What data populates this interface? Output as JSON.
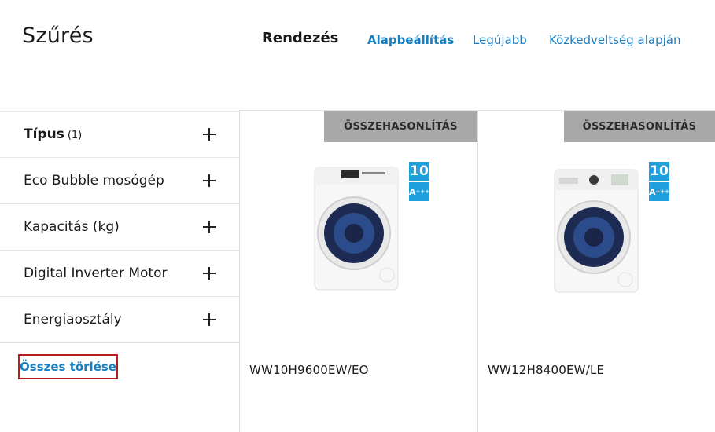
{
  "header": {
    "filter_title": "Szűrés",
    "sort_label": "Rendezés",
    "sort_options": [
      {
        "label": "Alapbeállítás",
        "active": true
      },
      {
        "label": "Legújabb",
        "active": false
      },
      {
        "label": "Közkedveltség alapján",
        "active": false
      }
    ]
  },
  "filters": [
    {
      "label": "Típus",
      "count": "(1)"
    },
    {
      "label": "Eco Bubble mosógép"
    },
    {
      "label": "Kapacitás (kg)"
    },
    {
      "label": "Digital Inverter Motor"
    },
    {
      "label": "Energiaosztály"
    }
  ],
  "clear_all_label": "Összes törlése",
  "products": [
    {
      "compare_label": "ÖSSZEHASONLÍTÁS",
      "energy_top": "10",
      "energy_class": "A",
      "energy_plus": "+++",
      "model": "WW10H9600EW/EO",
      "image": "washing-machine"
    },
    {
      "compare_label": "ÖSSZEHASONLÍTÁS",
      "energy_top": "10",
      "energy_class": "A",
      "energy_plus": "+++",
      "model": "WW12H8400EW/LE",
      "image": "washing-machine"
    }
  ],
  "colors": {
    "link": "#1a7fc0",
    "highlight_border": "#b41e1e",
    "compare_bg": "#a9a9a9",
    "energy_badge": "#1ea0dc"
  }
}
